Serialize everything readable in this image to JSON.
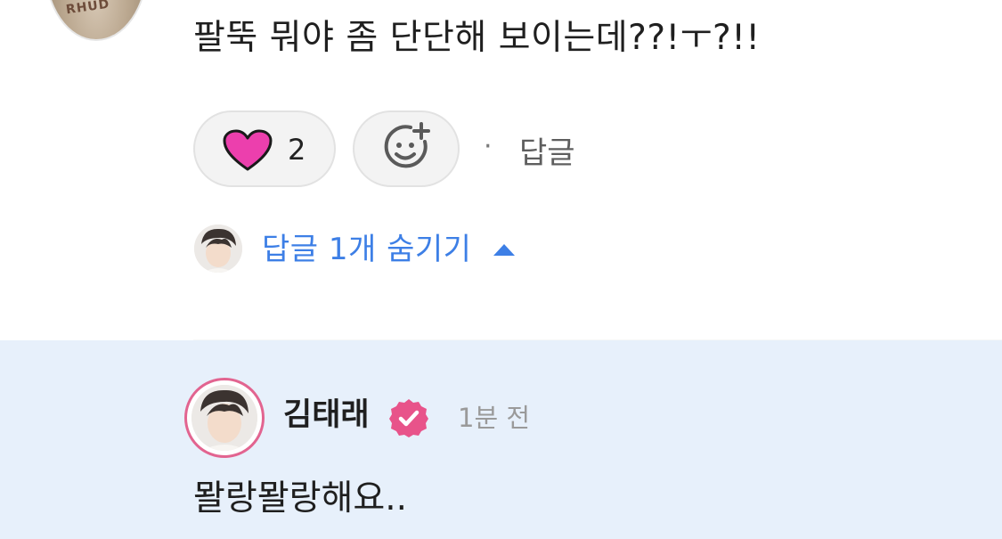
{
  "comment": {
    "text": "팔뚝 뭐야 좀 단단해 보이는데??!ㅜ?!!",
    "avatar_print": "RHUD",
    "like": {
      "icon": "heart-icon",
      "count": "2",
      "color": "#ec3fad"
    },
    "emoji_icon": "add-reaction-icon",
    "separator": "·",
    "reply_label": "답글"
  },
  "replies_toggle": {
    "label": "답글 1개 숨기기",
    "icon": "caret-up-icon",
    "color": "#3d7fe6"
  },
  "reply": {
    "author": "김태래",
    "verified_icon": "verified-badge-icon",
    "verified_color": "#e8538a",
    "time": "1분 전",
    "text": "뫌랑뫌랑해요..",
    "background": "#e7f0fb"
  }
}
